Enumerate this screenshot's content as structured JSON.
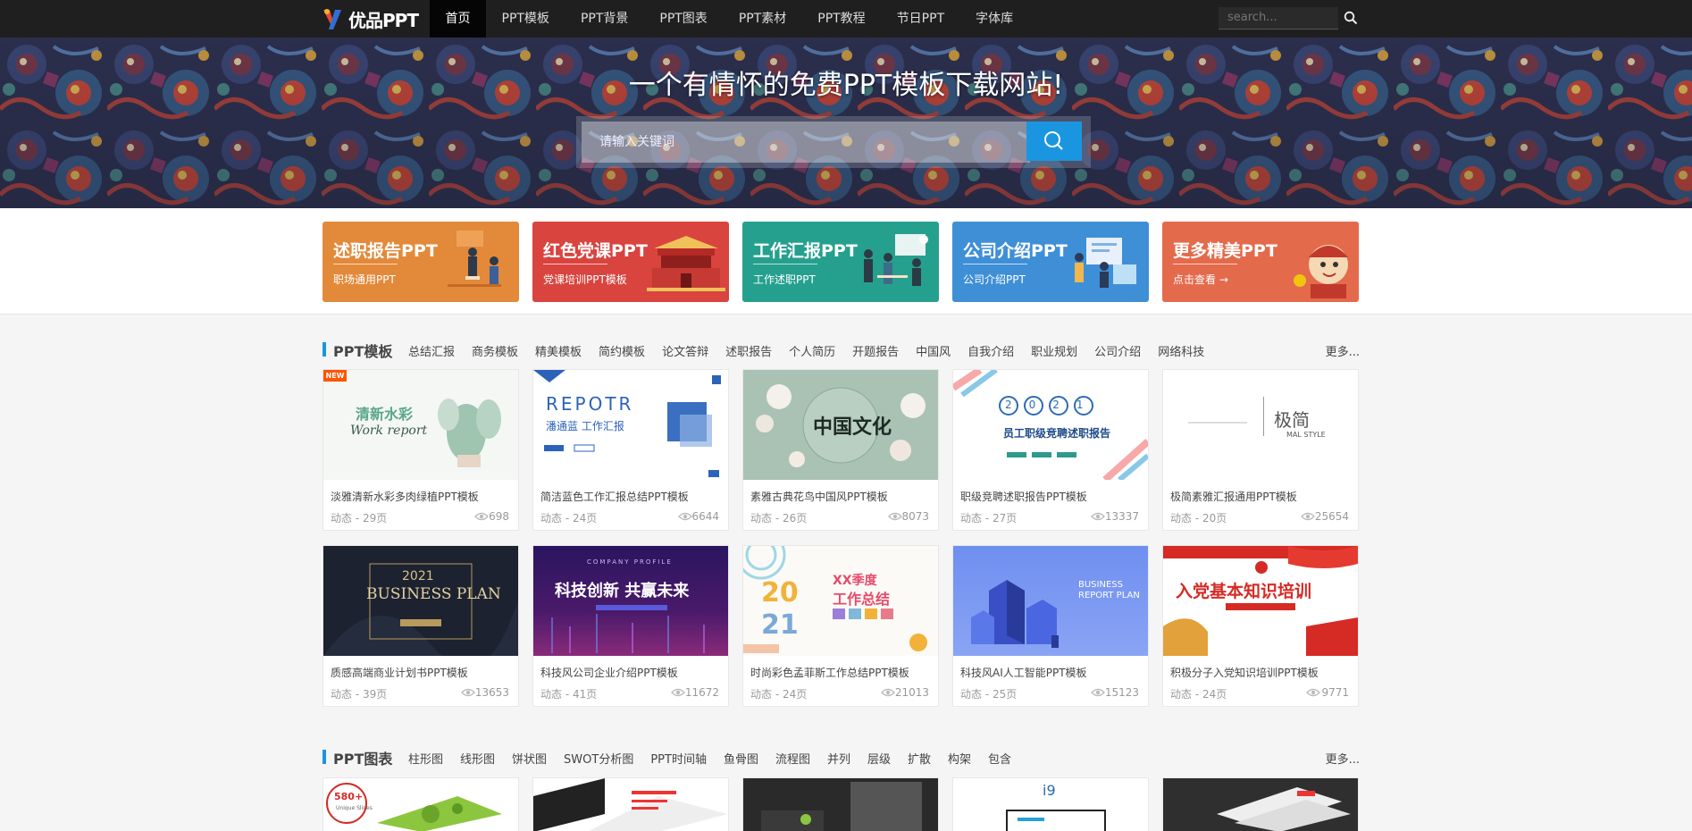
{
  "header": {
    "logo_text": "优品PPT",
    "nav": [
      "首页",
      "PPT模板",
      "PPT背景",
      "PPT图表",
      "PPT素材",
      "PPT教程",
      "节日PPT",
      "字体库"
    ],
    "search_placeholder": "search..."
  },
  "hero": {
    "title": "一个有情怀的免费PPT模板下载网站!",
    "search_placeholder": "请输入关键词"
  },
  "banners": [
    {
      "title": "述职报告PPT",
      "sub": "职场通用PPT",
      "color": "#e3893a"
    },
    {
      "title": "红色党课PPT",
      "sub": "党课培训PPT模板",
      "color": "#d9443f"
    },
    {
      "title": "工作汇报PPT",
      "sub": "工作述职PPT",
      "color": "#26a08e"
    },
    {
      "title": "公司介绍PPT",
      "sub": "公司介绍PPT",
      "color": "#3f8fd6"
    },
    {
      "title": "更多精美PPT",
      "sub": "点击查看 →",
      "color": "#e46a4c"
    }
  ],
  "sections": [
    {
      "title": "PPT模板",
      "tags": [
        "总结汇报",
        "商务模板",
        "精美模板",
        "简约模板",
        "论文答辩",
        "述职报告",
        "个人简历",
        "开题报告",
        "中国风",
        "自我介绍",
        "职业规划",
        "公司介绍",
        "网络科技"
      ],
      "more": "更多...",
      "new_badge": "NEW",
      "cards": [
        {
          "title": "淡雅清新水彩多肉绿植PPT模板",
          "meta": "动态 - 29页",
          "views": "698",
          "thumb_text": "清新水彩",
          "thumb_sub": "Work report"
        },
        {
          "title": "简洁蓝色工作汇报总结PPT模板",
          "meta": "动态 - 24页",
          "views": "6644",
          "thumb_text": "REPOTR",
          "thumb_sub": "潘通蓝 工作汇报"
        },
        {
          "title": "素雅古典花鸟中国风PPT模板",
          "meta": "动态 - 26页",
          "views": "8073",
          "thumb_text": "中国文化",
          "thumb_sub": ""
        },
        {
          "title": "职级竞聘述职报告PPT模板",
          "meta": "动态 - 27页",
          "views": "13337",
          "thumb_text": "员工职级竞聘述职报告",
          "thumb_sub": "2021"
        },
        {
          "title": "极简素雅汇报通用PPT模板",
          "meta": "动态 - 20页",
          "views": "25654",
          "thumb_text": "极简",
          "thumb_sub": "MAL STYLE"
        },
        {
          "title": "质感高端商业计划书PPT模板",
          "meta": "动态 - 39页",
          "views": "13653",
          "thumb_text": "BUSINESS PLAN",
          "thumb_sub": "2021"
        },
        {
          "title": "科技风公司企业介绍PPT模板",
          "meta": "动态 - 41页",
          "views": "11672",
          "thumb_text": "科技创新 共赢未来",
          "thumb_sub": "COMPANY PROFILE"
        },
        {
          "title": "时尚彩色孟菲斯工作总结PPT模板",
          "meta": "动态 - 24页",
          "views": "21013",
          "thumb_text": "XX季度",
          "thumb_sub": "工作总结"
        },
        {
          "title": "科技风AI人工智能PPT模板",
          "meta": "动态 - 25页",
          "views": "15123",
          "thumb_text": "BUSINESS",
          "thumb_sub": "REPORT PLAN"
        },
        {
          "title": "积极分子入党知识培训PPT模板",
          "meta": "动态 - 24页",
          "views": "9771",
          "thumb_text": "入党基本知识培训",
          "thumb_sub": ""
        }
      ]
    },
    {
      "title": "PPT图表",
      "tags": [
        "柱形图",
        "线形图",
        "饼状图",
        "SWOT分析图",
        "PPT时间轴",
        "鱼骨图",
        "流程图",
        "并列",
        "层级",
        "扩散",
        "构架",
        "包含"
      ],
      "more": "更多...",
      "cards": [
        {
          "thumb_text": "580+",
          "thumb_sub": "Unique Slides"
        },
        {
          "thumb_text": "",
          "thumb_sub": ""
        },
        {
          "thumb_text": "",
          "thumb_sub": ""
        },
        {
          "thumb_text": "i9",
          "thumb_sub": ""
        },
        {
          "thumb_text": "",
          "thumb_sub": ""
        }
      ]
    }
  ],
  "colors": {
    "accent": "#1a96e0",
    "nav_bg": "#1f1f1f",
    "new_badge": "#ff5400"
  }
}
